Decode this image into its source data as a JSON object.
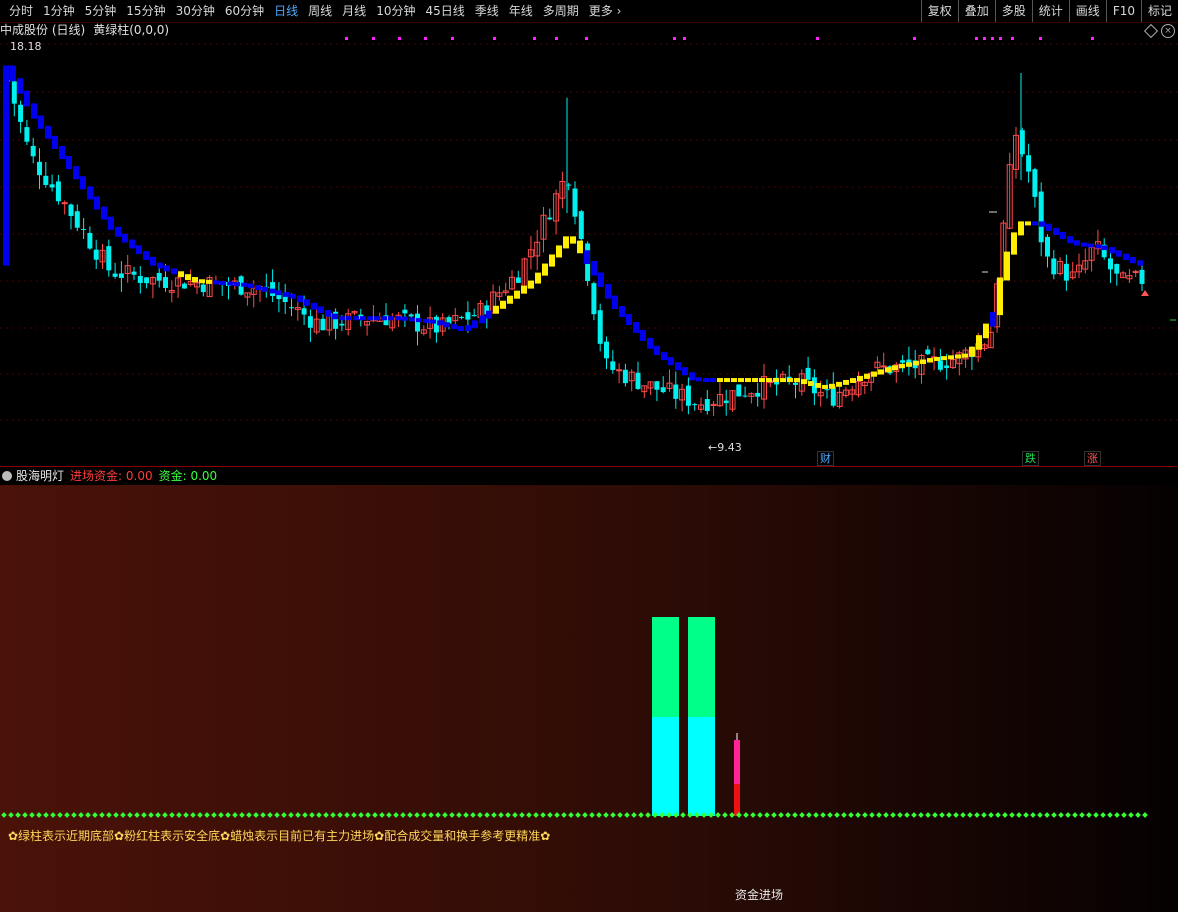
{
  "toolbar": {
    "periods": [
      "分时",
      "1分钟",
      "5分钟",
      "15分钟",
      "30分钟",
      "60分钟",
      "日线",
      "周线",
      "月线",
      "10分钟",
      "45日线",
      "季线",
      "年线",
      "多周期",
      "更多 ›"
    ],
    "active_period": "日线",
    "right_buttons": [
      "复权",
      "叠加",
      "多股",
      "统计",
      "画线",
      "F10",
      "标记"
    ]
  },
  "header": {
    "stock": "中成股份 (日线)",
    "indicator": "黄绿柱(0,0,0)"
  },
  "main": {
    "high_label": "18.18",
    "low_label": "←9.43",
    "event_tags": [
      {
        "text": "财",
        "color": "#4fa8ff"
      },
      {
        "text": "跌",
        "color": "#22dd55"
      },
      {
        "text": "涨",
        "color": "#ff5555"
      }
    ]
  },
  "sub": {
    "title": "股海明灯",
    "inflow_label": "进场资金: 0.00",
    "fund_label": "资金: 0.00",
    "note": "✿绿柱表示近期底部✿粉红柱表示安全底✿蜡烛表示目前已有主力进场✿配合成交量和换手参考更精准✿",
    "bottom_label": "资金进场"
  },
  "colors": {
    "up": "#ff4a4a",
    "down": "#00f0f0",
    "blue_band": "#0000ee",
    "yellow_band": "#ffee00",
    "green_bar": "#00ff88",
    "cyan_bar": "#00ffff",
    "pink": "#ff2299",
    "dots": "#33ff33",
    "magenta_marks": "#ff22ff"
  }
}
